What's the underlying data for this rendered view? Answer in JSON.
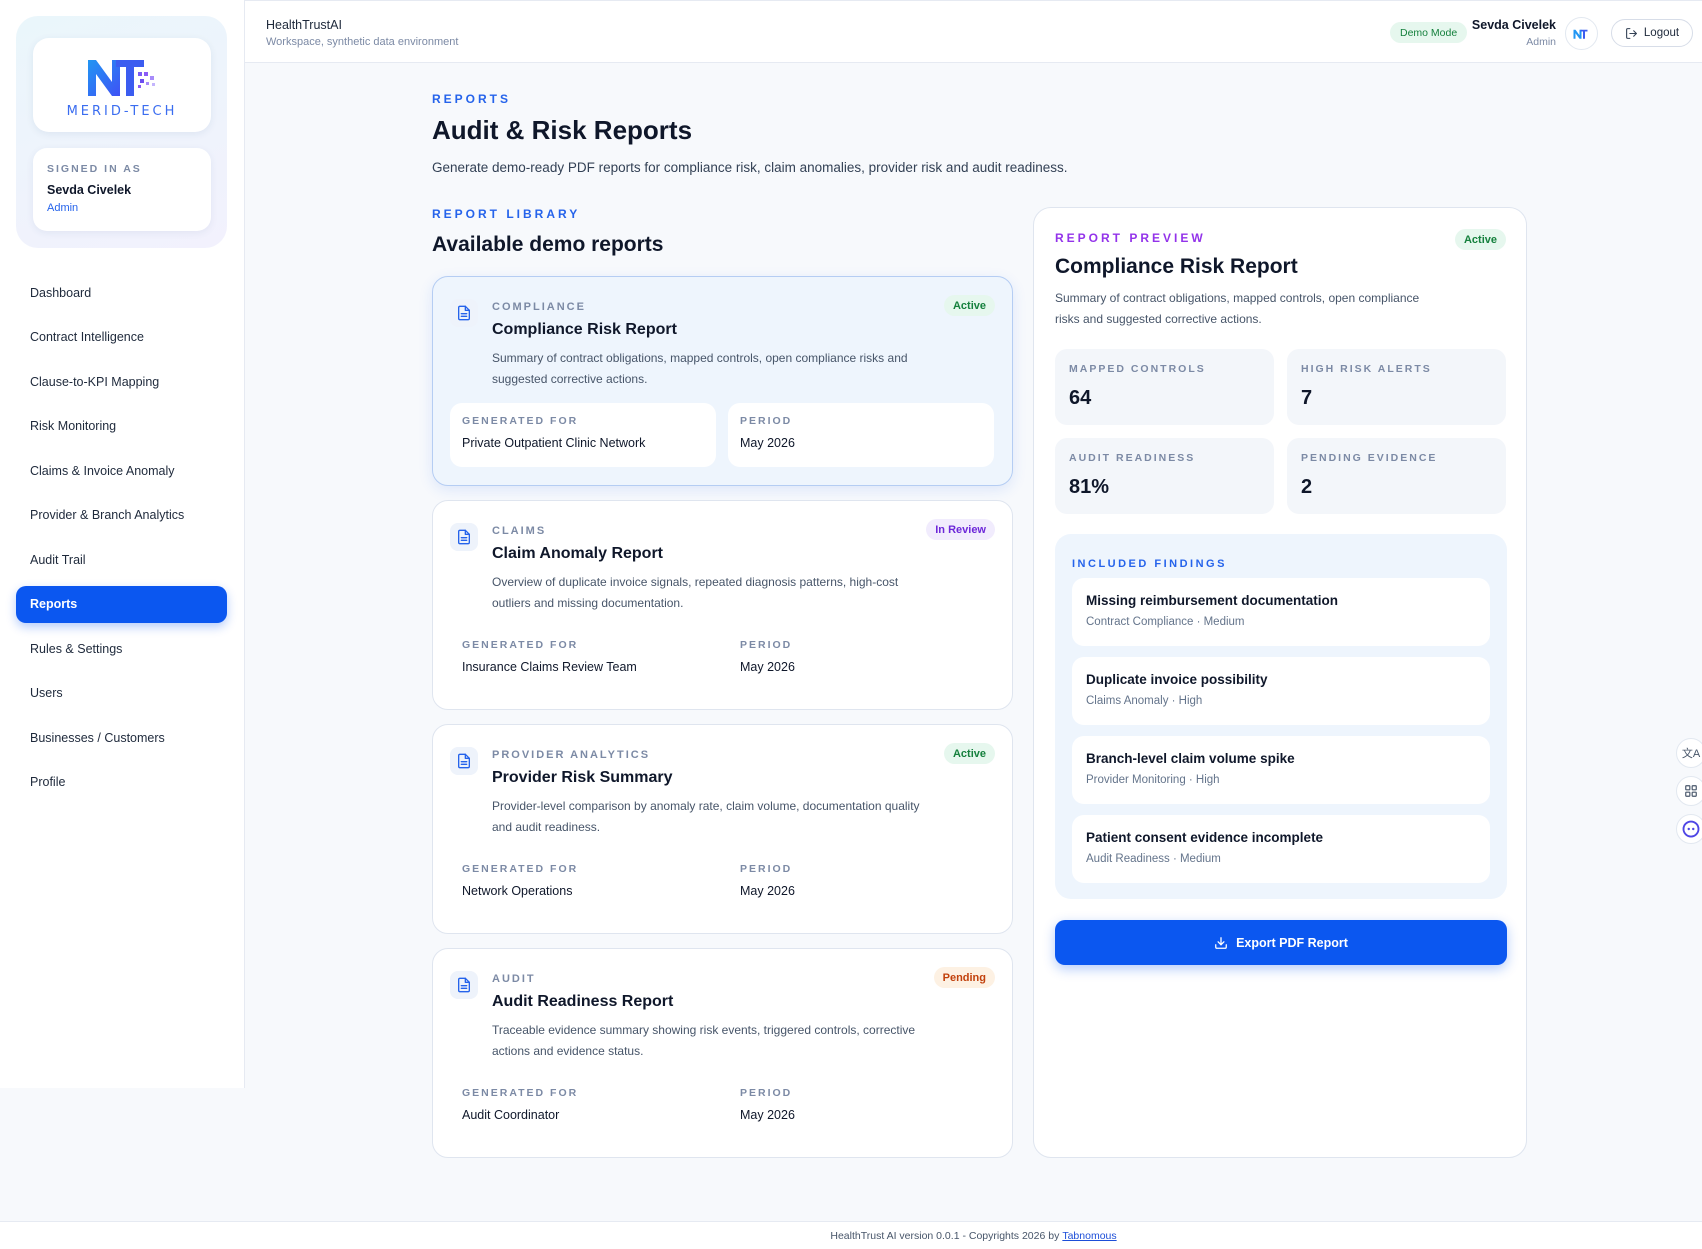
{
  "brand": {
    "logo_text": "MERID-TECH"
  },
  "signed_in": {
    "label": "SIGNED IN AS",
    "name": "Sevda Civelek",
    "role": "Admin"
  },
  "nav": {
    "items": [
      {
        "label": "Dashboard"
      },
      {
        "label": "Contract Intelligence"
      },
      {
        "label": "Clause-to-KPI Mapping"
      },
      {
        "label": "Risk Monitoring"
      },
      {
        "label": "Claims & Invoice Anomaly"
      },
      {
        "label": "Provider & Branch Analytics"
      },
      {
        "label": "Audit Trail"
      },
      {
        "label": "Reports",
        "active": true
      },
      {
        "label": "Rules & Settings"
      },
      {
        "label": "Users"
      },
      {
        "label": "Businesses / Customers"
      },
      {
        "label": "Profile"
      }
    ]
  },
  "topbar": {
    "app_name": "HealthTrustAI",
    "app_subtitle": "Workspace, synthetic data environment",
    "demo_badge": "Demo Mode",
    "user_name": "Sevda Civelek",
    "user_role": "Admin",
    "logout_label": "Logout"
  },
  "page": {
    "eyebrow": "REPORTS",
    "title": "Audit & Risk Reports",
    "description": "Generate demo-ready PDF reports for compliance risk, claim anomalies, provider risk and audit readiness."
  },
  "library": {
    "eyebrow": "REPORT LIBRARY",
    "title": "Available demo reports",
    "generated_for_label": "GENERATED FOR",
    "period_label": "PERIOD",
    "reports": [
      {
        "category": "COMPLIANCE",
        "title": "Compliance Risk Report",
        "description": "Summary of contract obligations, mapped controls, open compliance risks and suggested corrective actions.",
        "status": "Active",
        "generated_for": "Private Outpatient Clinic Network",
        "period": "May 2026"
      },
      {
        "category": "CLAIMS",
        "title": "Claim Anomaly Report",
        "description": "Overview of duplicate invoice signals, repeated diagnosis patterns, high-cost outliers and missing documentation.",
        "status": "In Review",
        "generated_for": "Insurance Claims Review Team",
        "period": "May 2026"
      },
      {
        "category": "PROVIDER ANALYTICS",
        "title": "Provider Risk Summary",
        "description": "Provider-level comparison by anomaly rate, claim volume, documentation quality and audit readiness.",
        "status": "Active",
        "generated_for": "Network Operations",
        "period": "May 2026"
      },
      {
        "category": "AUDIT",
        "title": "Audit Readiness Report",
        "description": "Traceable evidence summary showing risk events, triggered controls, corrective actions and evidence status.",
        "status": "Pending",
        "generated_for": "Audit Coordinator",
        "period": "May 2026"
      }
    ]
  },
  "preview": {
    "eyebrow": "REPORT PREVIEW",
    "status": "Active",
    "title": "Compliance Risk Report",
    "description": "Summary of contract obligations, mapped controls, open compliance risks and suggested corrective actions.",
    "metrics": [
      {
        "label": "MAPPED CONTROLS",
        "value": "64"
      },
      {
        "label": "HIGH RISK ALERTS",
        "value": "7"
      },
      {
        "label": "AUDIT READINESS",
        "value": "81%"
      },
      {
        "label": "PENDING EVIDENCE",
        "value": "2"
      }
    ],
    "findings_label": "INCLUDED FINDINGS",
    "findings": [
      {
        "title": "Missing reimbursement documentation",
        "meta": "Contract Compliance · Medium"
      },
      {
        "title": "Duplicate invoice possibility",
        "meta": "Claims Anomaly · High"
      },
      {
        "title": "Branch-level claim volume spike",
        "meta": "Provider Monitoring · High"
      },
      {
        "title": "Patient consent evidence incomplete",
        "meta": "Audit Readiness · Medium"
      }
    ],
    "export_label": "Export PDF Report"
  },
  "footer": {
    "text": "HealthTrust AI version 0.0.1 - Copyrights 2026 by",
    "link": "Tabnomous"
  },
  "colors": {
    "primary": "#0b57f0",
    "accent_blue": "#2563eb",
    "accent_purple": "#9333ea",
    "success": "#15803d",
    "review": "#6d28d9",
    "pending": "#c2410c"
  }
}
